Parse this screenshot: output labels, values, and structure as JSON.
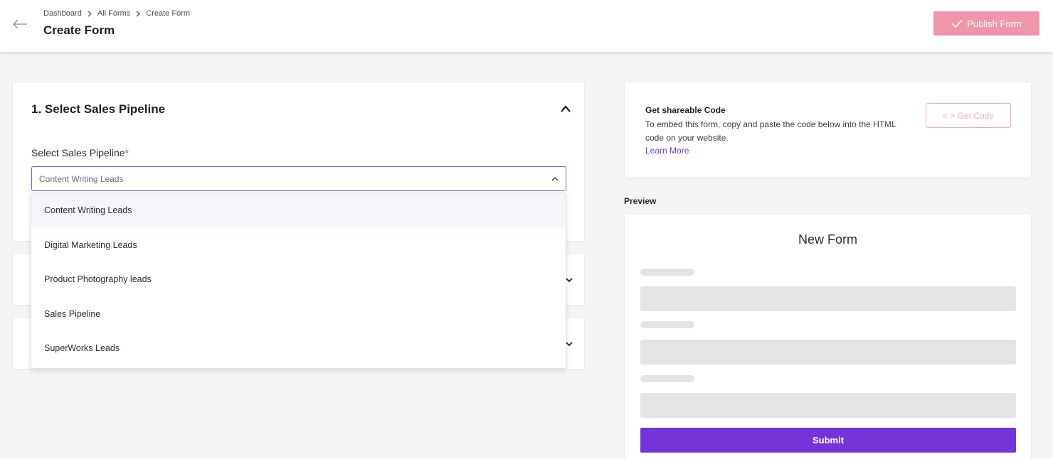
{
  "header": {
    "breadcrumbs": [
      "Dashboard",
      "All Forms",
      "Create Form"
    ],
    "title": "Create Form",
    "publish_label": "Publish Form",
    "publish_color": "#f096ac"
  },
  "pipeline_card": {
    "title": "1. Select Sales Pipeline",
    "field_label": "Select Sales Pipeline",
    "required_mark": "*",
    "selected_value": "Content Writing Leads",
    "options": [
      "Content Writing Leads",
      "Digital Marketing Leads",
      "Product Photography leads",
      "Sales Pipeline",
      "SuperWorks Leads"
    ]
  },
  "code_card": {
    "title": "Get shareable Code",
    "description": "To embed this form, copy and paste the code below into the HTML code on your website.",
    "learn_more": "Learn More",
    "button_label": "< > Get Code"
  },
  "preview": {
    "label": "Preview",
    "form_title": "New Form",
    "submit_label": "Submit",
    "submit_color": "#7434d9"
  },
  "icons": [
    "back-arrow-icon",
    "chevron-right-icon",
    "check-icon",
    "chevron-up-icon",
    "chevron-down-icon"
  ]
}
